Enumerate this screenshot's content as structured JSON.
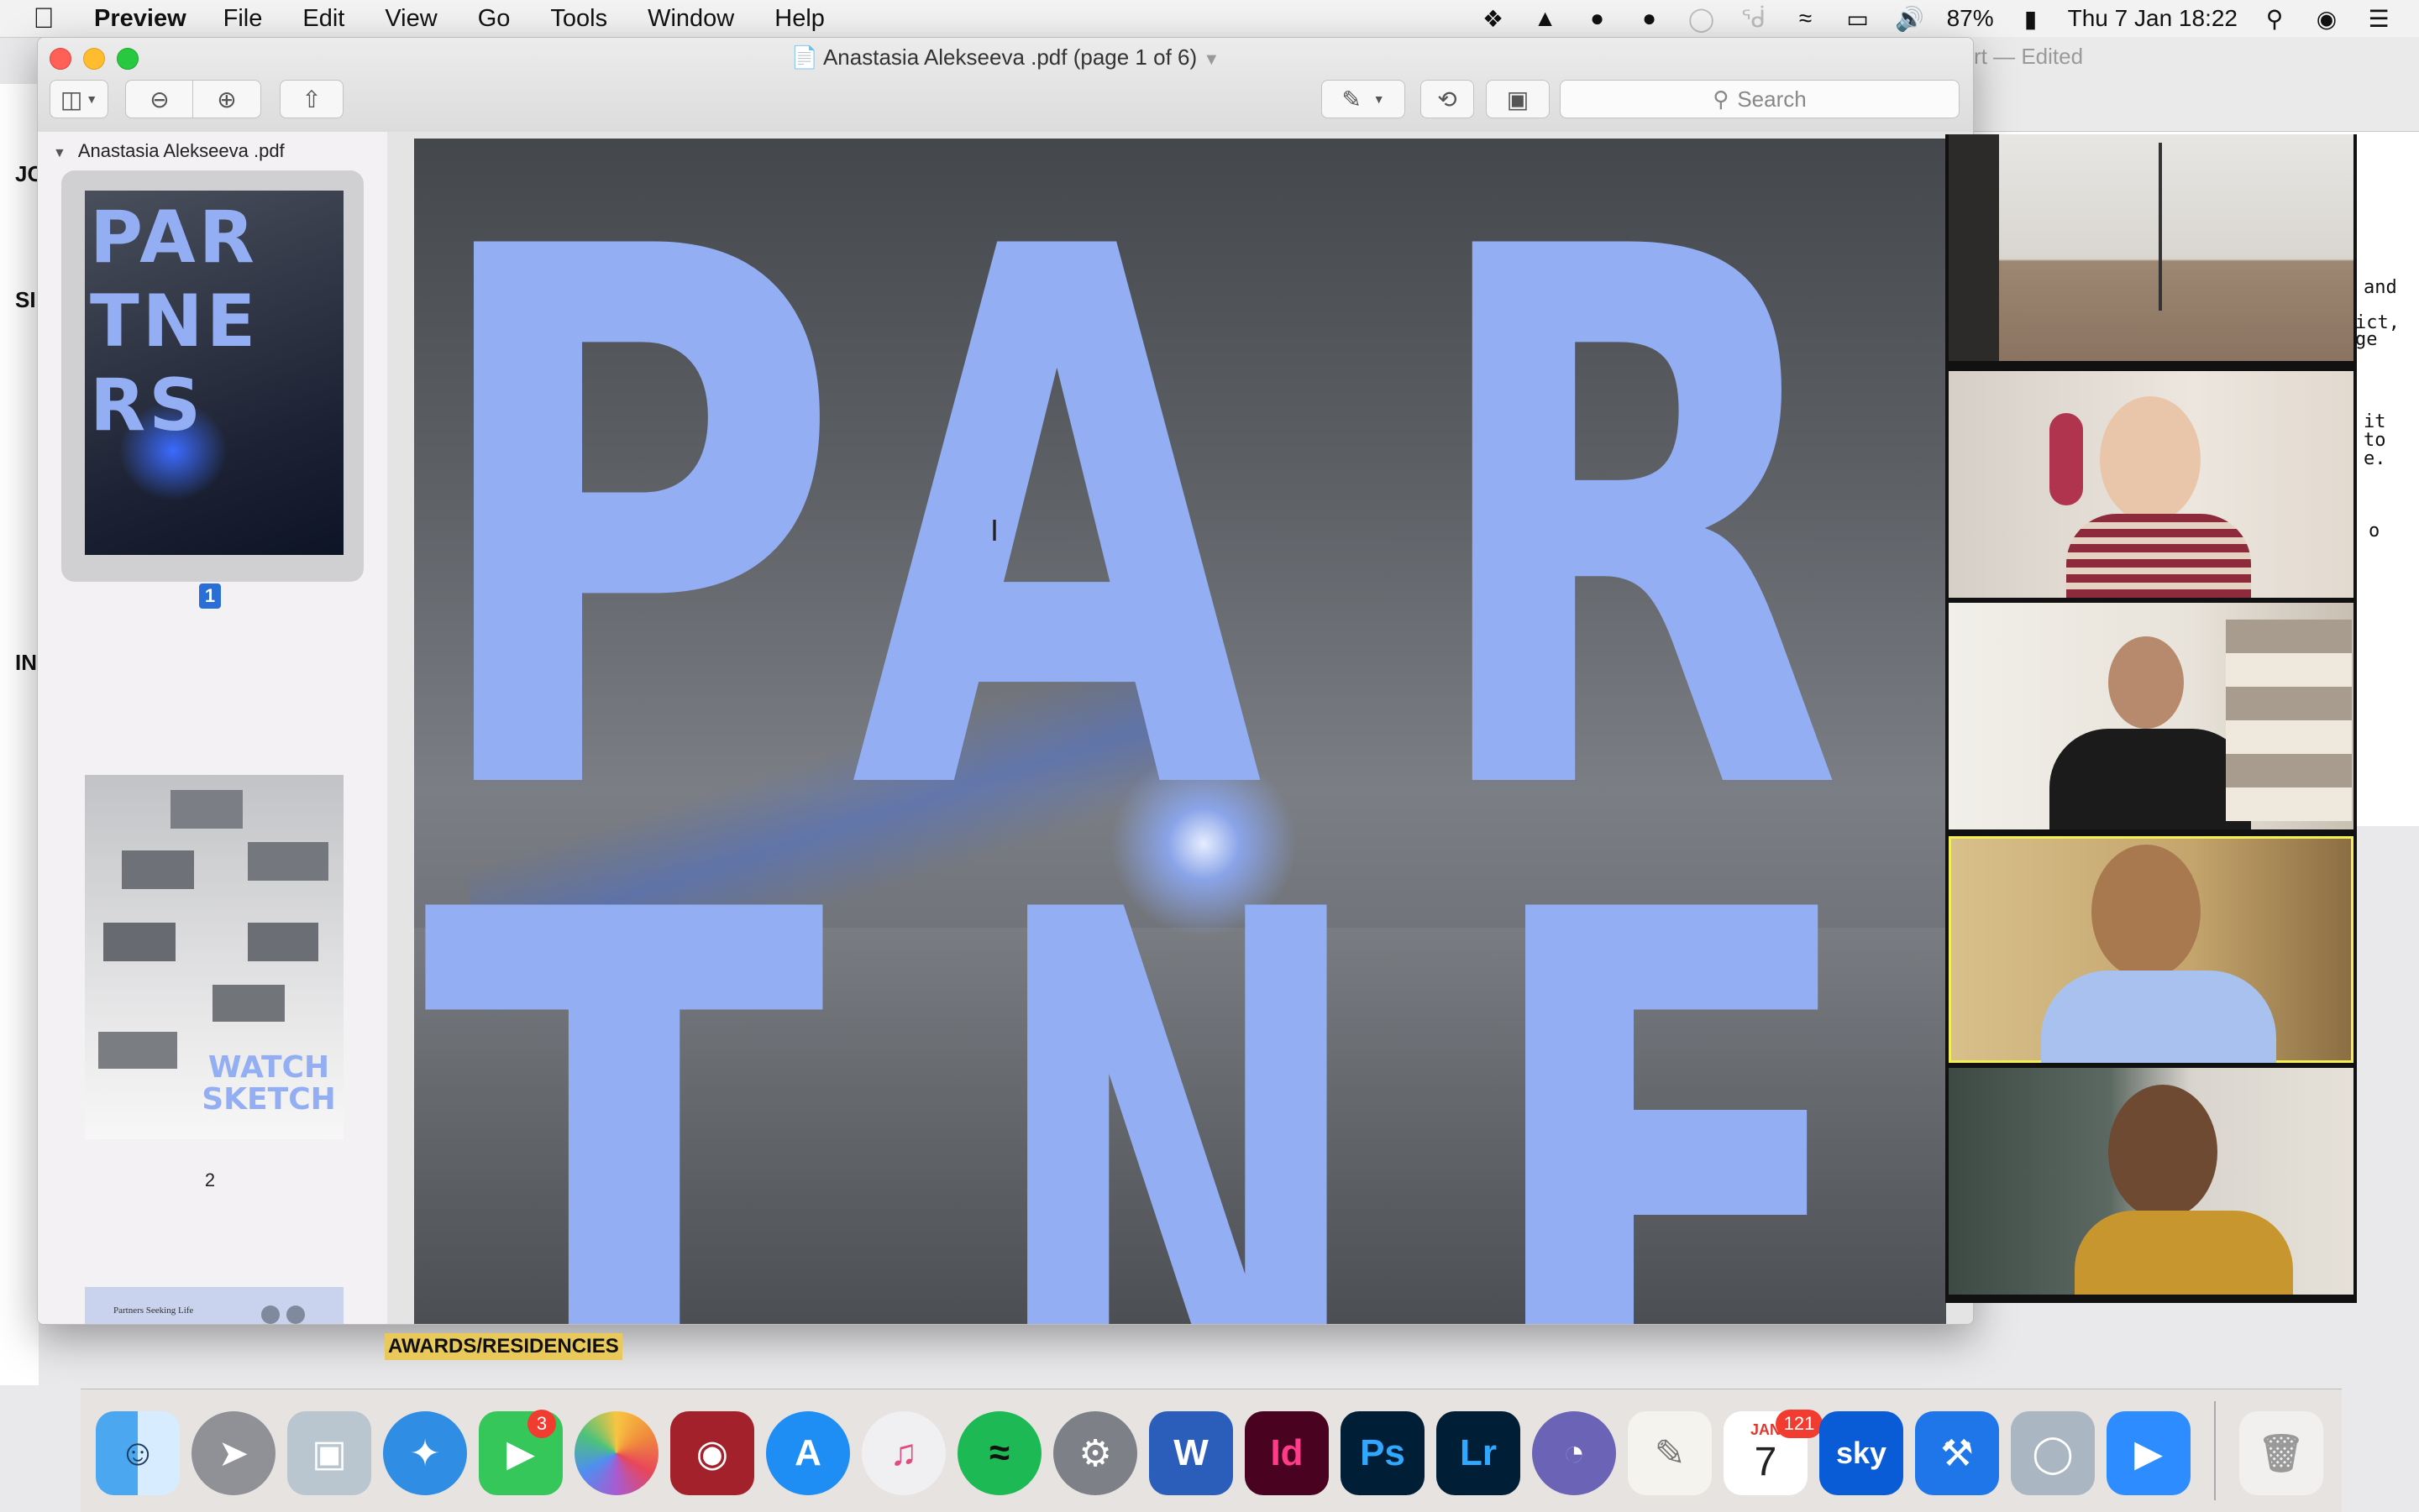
{
  "menubar": {
    "app": "Preview",
    "menus": [
      "File",
      "Edit",
      "View",
      "Go",
      "Tools",
      "Window",
      "Help"
    ],
    "battery": "87%",
    "clock": "Thu 7 Jan  18:22"
  },
  "background_window": {
    "title_fragment": "rt — Edited",
    "text_lines": [
      "and",
      "ict,",
      "ge",
      "it",
      "to",
      "e.",
      "o"
    ],
    "left_letters": [
      "JC",
      "SI",
      "IN"
    ]
  },
  "preview": {
    "window_title": "Anastasia Alekseeva .pdf (page 1 of 6)",
    "search_placeholder": "Search",
    "sidebar_header": "Anastasia Alekseeva .pdf",
    "thumbnails": [
      {
        "page": "1",
        "selected": true,
        "lines": [
          "PAR",
          "TNE",
          "RS"
        ]
      },
      {
        "page": "2",
        "selected": false,
        "lines": [
          "WATCH",
          "SKETCH"
        ]
      },
      {
        "page": "3",
        "selected": false,
        "caption": "Partners Seeking Life"
      }
    ],
    "page_letters": [
      "P",
      "A",
      "R",
      "T",
      "N",
      "E"
    ],
    "accent": "#93aef2"
  },
  "videos": [
    {
      "label": "participant-1"
    },
    {
      "label": "participant-2"
    },
    {
      "label": "participant-3"
    },
    {
      "label": "participant-4",
      "speaking": true
    },
    {
      "label": "participant-5"
    }
  ],
  "caption_label": "AWARDS/RESIDENCIES",
  "dock": {
    "facetime_badge": "3",
    "calendar_month": "JAN",
    "calendar_day": "7",
    "calendar_badge": "121",
    "apps": [
      "Finder",
      "Launchpad",
      "Preview",
      "Safari",
      "FaceTime",
      "Photos",
      "Photo Booth",
      "App Store",
      "iTunes",
      "Spotify",
      "System Preferences",
      "Word",
      "InDesign",
      "Photoshop",
      "Lightroom",
      "Creative Cloud",
      "TextEdit",
      "Calendar",
      "Sky Go",
      "Xcode",
      "Preview Viewer",
      "Zoom",
      "Trash"
    ]
  }
}
